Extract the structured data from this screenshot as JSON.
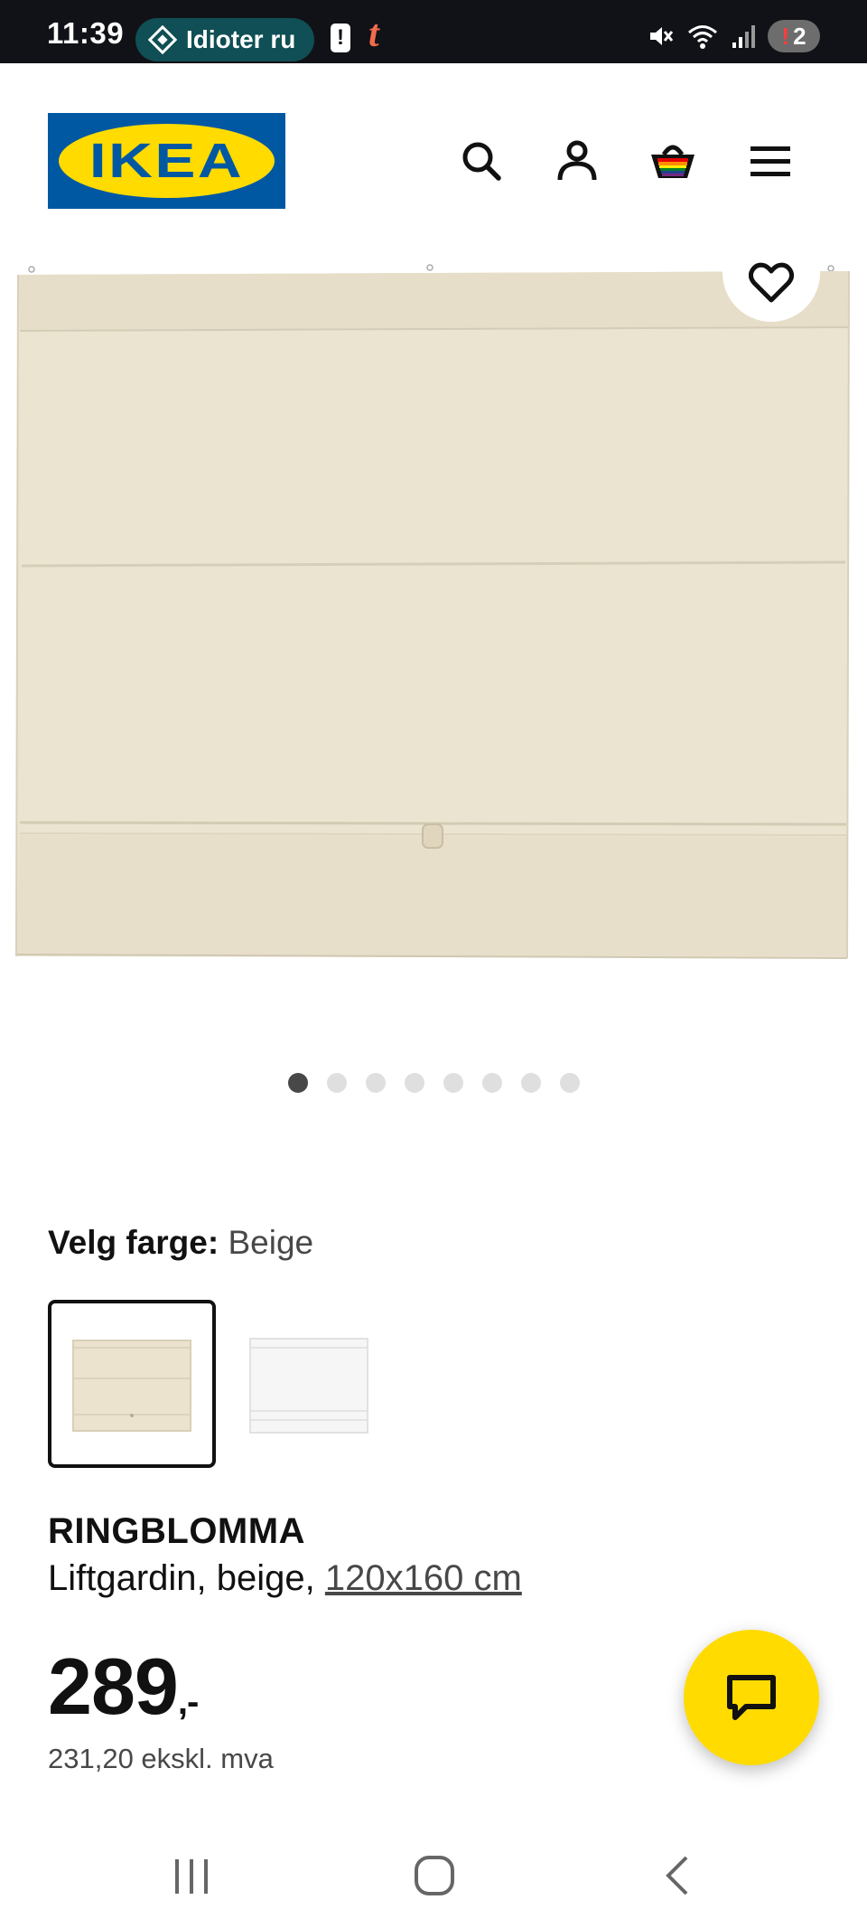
{
  "status_bar": {
    "time": "11:39",
    "notification_pill": "Idioter ru",
    "alert_glyph": "!",
    "app_glyph": "t",
    "badge_count": "2",
    "badge_exclamation": "!"
  },
  "header": {
    "logo_text": "IKEA",
    "icons": [
      "search-icon",
      "account-icon",
      "cart-icon",
      "menu-icon"
    ]
  },
  "gallery": {
    "image_count": 8,
    "active_index": 0
  },
  "color": {
    "label": "Velg farge:",
    "value": "Beige",
    "options": [
      {
        "name": "beige",
        "color": "#ebe3cd",
        "selected": true
      },
      {
        "name": "white",
        "color": "#f6f6f6",
        "selected": false
      }
    ]
  },
  "product": {
    "name": "RINGBLOMMA",
    "description": "Liftgardin, beige,",
    "size": "120x160 cm",
    "price": "289",
    "price_suffix": ",-",
    "price_ex_vat": "231,20 ekskl. mva"
  },
  "colors": {
    "ikea_blue": "#0058a3",
    "ikea_yellow": "#ffdb00",
    "blind_beige": "#ebe3cd"
  }
}
